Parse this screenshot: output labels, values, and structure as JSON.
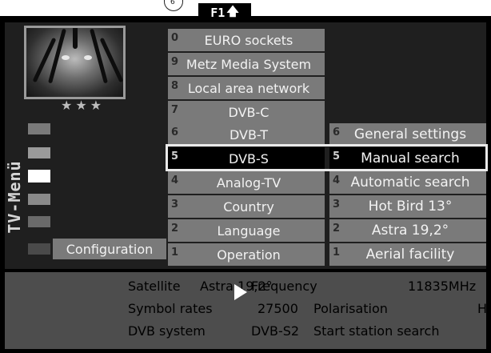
{
  "header": {
    "hint_glyph": "6",
    "f1_label": "F1",
    "f1_arrow": "🡅"
  },
  "preview": {
    "stars": "★★★"
  },
  "side_menu": {
    "title": "TV-Menü",
    "config_label": "Configuration"
  },
  "main_menu": {
    "items": [
      {
        "num": "0",
        "label": "EURO sockets"
      },
      {
        "num": "9",
        "label": "Metz Media System"
      },
      {
        "num": "8",
        "label": "Local area network"
      },
      {
        "num": "7",
        "label": "DVB-C"
      },
      {
        "num": "6",
        "label": "DVB-T"
      },
      {
        "num": "5",
        "label": "DVB-S"
      },
      {
        "num": "4",
        "label": "Analog-TV"
      },
      {
        "num": "3",
        "label": "Country"
      },
      {
        "num": "2",
        "label": "Language"
      },
      {
        "num": "1",
        "label": "Operation"
      }
    ],
    "selected_index": 5
  },
  "sub_menu": {
    "items": [
      {
        "num": "6",
        "label": "General settings"
      },
      {
        "num": "5",
        "label": "Manual search"
      },
      {
        "num": "4",
        "label": "Automatic search"
      },
      {
        "num": "3",
        "label": "Hot Bird 13°"
      },
      {
        "num": "2",
        "label": "Astra 19,2°"
      },
      {
        "num": "1",
        "label": "Aerial facility"
      }
    ],
    "selected_index": 1
  },
  "info": {
    "satellite_label": "Satellite",
    "satellite_value": "Astra 19,2°",
    "frequency_label": "Frequency",
    "frequency_value": "11835MHz",
    "symbol_label": "Symbol rates",
    "symbol_value": "27500",
    "polarisation_label": "Polarisation",
    "polarisation_value": "H",
    "dvb_label": "DVB system",
    "dvb_value": "DVB-S2",
    "start_search": "Start station search"
  },
  "colors": {
    "menu_item": "#7a7a7a",
    "selected": "#000000",
    "info_bg": "#4d4d4d",
    "frame": "#1f1f1f"
  }
}
